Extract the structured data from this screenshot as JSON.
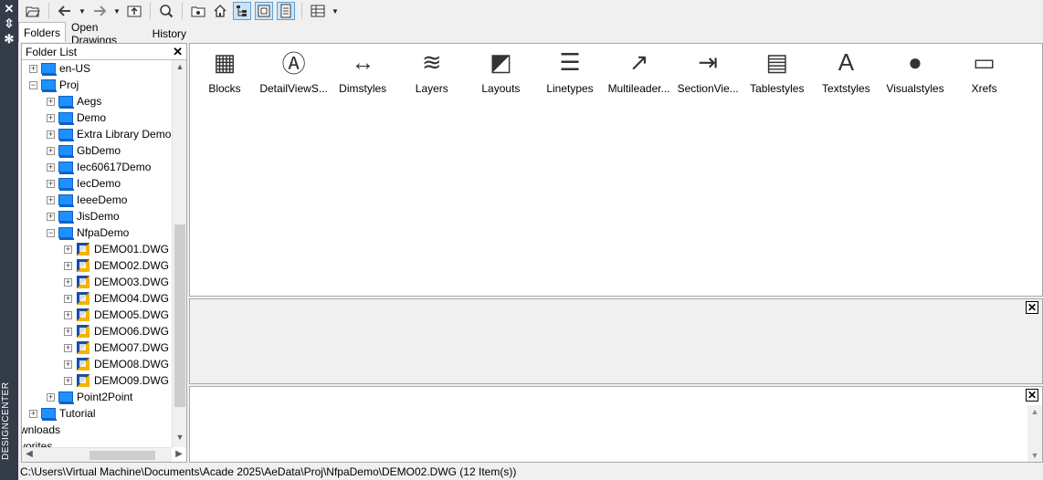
{
  "sidebar_strip": {
    "close_glyph": "✕",
    "pin_glyph": "⇳",
    "props_glyph": "✻",
    "title": "DESIGNCENTER"
  },
  "toolbar": {
    "icons": [
      "load-icon",
      "back-icon",
      "forward-icon",
      "up-icon",
      "search-icon",
      "favorites-icon",
      "home-icon",
      "tree-view-icon",
      "preview-icon",
      "description-icon",
      "views-icon"
    ]
  },
  "tabs": [
    {
      "label": "Folders"
    },
    {
      "label": "Open Drawings"
    },
    {
      "label": "History"
    }
  ],
  "folder_list": {
    "title": "Folder List",
    "close_glyph": "✕",
    "rows": [
      {
        "label": "en-US",
        "type": "folder",
        "level": 0,
        "expander": "+"
      },
      {
        "label": "Proj",
        "type": "folder",
        "level": 0,
        "expander": "−"
      },
      {
        "label": "Aegs",
        "type": "folder",
        "level": 1,
        "expander": "+"
      },
      {
        "label": "Demo",
        "type": "folder",
        "level": 1,
        "expander": "+"
      },
      {
        "label": "Extra Library Demo",
        "type": "folder",
        "level": 1,
        "expander": "+"
      },
      {
        "label": "GbDemo",
        "type": "folder",
        "level": 1,
        "expander": "+"
      },
      {
        "label": "Iec60617Demo",
        "type": "folder",
        "level": 1,
        "expander": "+"
      },
      {
        "label": "IecDemo",
        "type": "folder",
        "level": 1,
        "expander": "+"
      },
      {
        "label": "IeeeDemo",
        "type": "folder",
        "level": 1,
        "expander": "+"
      },
      {
        "label": "JisDemo",
        "type": "folder",
        "level": 1,
        "expander": "+"
      },
      {
        "label": "NfpaDemo",
        "type": "folder",
        "level": 1,
        "expander": "−"
      },
      {
        "label": "DEMO01.DWG",
        "type": "dwg",
        "level": 2,
        "expander": "+"
      },
      {
        "label": "DEMO02.DWG",
        "type": "dwg",
        "level": 2,
        "expander": "+"
      },
      {
        "label": "DEMO03.DWG",
        "type": "dwg",
        "level": 2,
        "expander": "+"
      },
      {
        "label": "DEMO04.DWG",
        "type": "dwg",
        "level": 2,
        "expander": "+"
      },
      {
        "label": "DEMO05.DWG",
        "type": "dwg",
        "level": 2,
        "expander": "+"
      },
      {
        "label": "DEMO06.DWG",
        "type": "dwg",
        "level": 2,
        "expander": "+"
      },
      {
        "label": "DEMO07.DWG",
        "type": "dwg",
        "level": 2,
        "expander": "+"
      },
      {
        "label": "DEMO08.DWG",
        "type": "dwg",
        "level": 2,
        "expander": "+"
      },
      {
        "label": "DEMO09.DWG",
        "type": "dwg",
        "level": 2,
        "expander": "+"
      },
      {
        "label": "Point2Point",
        "type": "folder",
        "level": 1,
        "expander": "+"
      },
      {
        "label": "Tutorial",
        "type": "folder",
        "level": 0,
        "expander": "+"
      },
      {
        "label": "wnloads",
        "type": "text",
        "level": -1,
        "expander": ""
      },
      {
        "label": "vorites",
        "type": "text",
        "level": -1,
        "expander": ""
      }
    ]
  },
  "content_items": [
    {
      "label": "Blocks",
      "icon": "blocks-icon",
      "glyph": "▦"
    },
    {
      "label": "DetailViewS...",
      "icon": "detail-view-icon",
      "glyph": "Ⓐ"
    },
    {
      "label": "Dimstyles",
      "icon": "dimstyles-icon",
      "glyph": "↔"
    },
    {
      "label": "Layers",
      "icon": "layers-icon",
      "glyph": "≋"
    },
    {
      "label": "Layouts",
      "icon": "layouts-icon",
      "glyph": "◩"
    },
    {
      "label": "Linetypes",
      "icon": "linetypes-icon",
      "glyph": "☰"
    },
    {
      "label": "Multileader...",
      "icon": "multileader-icon",
      "glyph": "↗"
    },
    {
      "label": "SectionVie...",
      "icon": "section-view-icon",
      "glyph": "⇥"
    },
    {
      "label": "Tablestyles",
      "icon": "tablestyles-icon",
      "glyph": "▤"
    },
    {
      "label": "Textstyles",
      "icon": "textstyles-icon",
      "glyph": "A"
    },
    {
      "label": "Visualstyles",
      "icon": "visualstyles-icon",
      "glyph": "●"
    },
    {
      "label": "Xrefs",
      "icon": "xrefs-icon",
      "glyph": "▭"
    }
  ],
  "preview_close": "✕",
  "description_close": "✕",
  "status_bar": {
    "text": "C:\\Users\\Virtual Machine\\Documents\\Acade 2025\\AeData\\Proj\\NfpaDemo\\DEMO02.DWG (12 Item(s))"
  }
}
